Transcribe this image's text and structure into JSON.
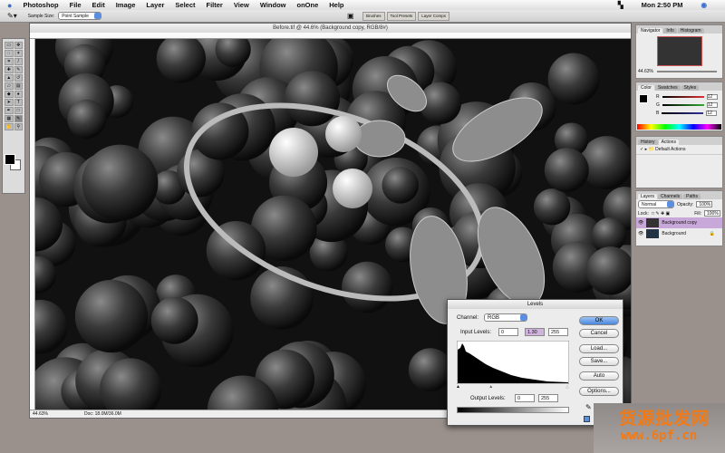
{
  "menubar": {
    "app": "Photoshop",
    "items": [
      "File",
      "Edit",
      "Image",
      "Layer",
      "Select",
      "Filter",
      "View",
      "Window",
      "onOne",
      "Help"
    ],
    "clock": "Mon 2:50 PM"
  },
  "options": {
    "sample_size_label": "Sample Size:",
    "sample_size_value": "Point Sample",
    "well_tabs": [
      "Brushes",
      "Tool Presets",
      "Layer Comps"
    ]
  },
  "document": {
    "title": "Before.tif @ 44.6% (Background copy, RGB/8#)",
    "zoom": "44.63%",
    "doc_size": "Doc: 18.0M/36.0M"
  },
  "navigator": {
    "tabs": [
      "Navigator",
      "Info",
      "Histogram"
    ],
    "zoom": "44.63%"
  },
  "color": {
    "tabs": [
      "Color",
      "Swatches",
      "Styles"
    ],
    "channels": [
      {
        "label": "R",
        "value": "12",
        "color": "#d33"
      },
      {
        "label": "G",
        "value": "12",
        "color": "#3a3"
      },
      {
        "label": "B",
        "value": "12",
        "color": "#339"
      }
    ]
  },
  "actions": {
    "tabs": [
      "History",
      "Actions"
    ],
    "item": "Default Actions"
  },
  "layers": {
    "tabs": [
      "Layers",
      "Channels",
      "Paths"
    ],
    "blend": "Normal",
    "opacity_label": "Opacity:",
    "opacity": "100%",
    "lock_label": "Lock:",
    "fill_label": "Fill:",
    "fill": "100%",
    "items": [
      {
        "name": "Background copy",
        "selected": true
      },
      {
        "name": "Background",
        "selected": false
      }
    ]
  },
  "levels": {
    "title": "Levels",
    "channel_label": "Channel:",
    "channel": "RGB",
    "input_label": "Input Levels:",
    "input": [
      "0",
      "1.30",
      "255"
    ],
    "output_label": "Output Levels:",
    "output": [
      "0",
      "255"
    ],
    "buttons": [
      "OK",
      "Cancel",
      "Load...",
      "Save...",
      "Auto",
      "Options..."
    ],
    "midpoint_fraction": 0.3
  },
  "watermark": {
    "line1": "货源批发网",
    "line2": "www.6pf.cn"
  }
}
